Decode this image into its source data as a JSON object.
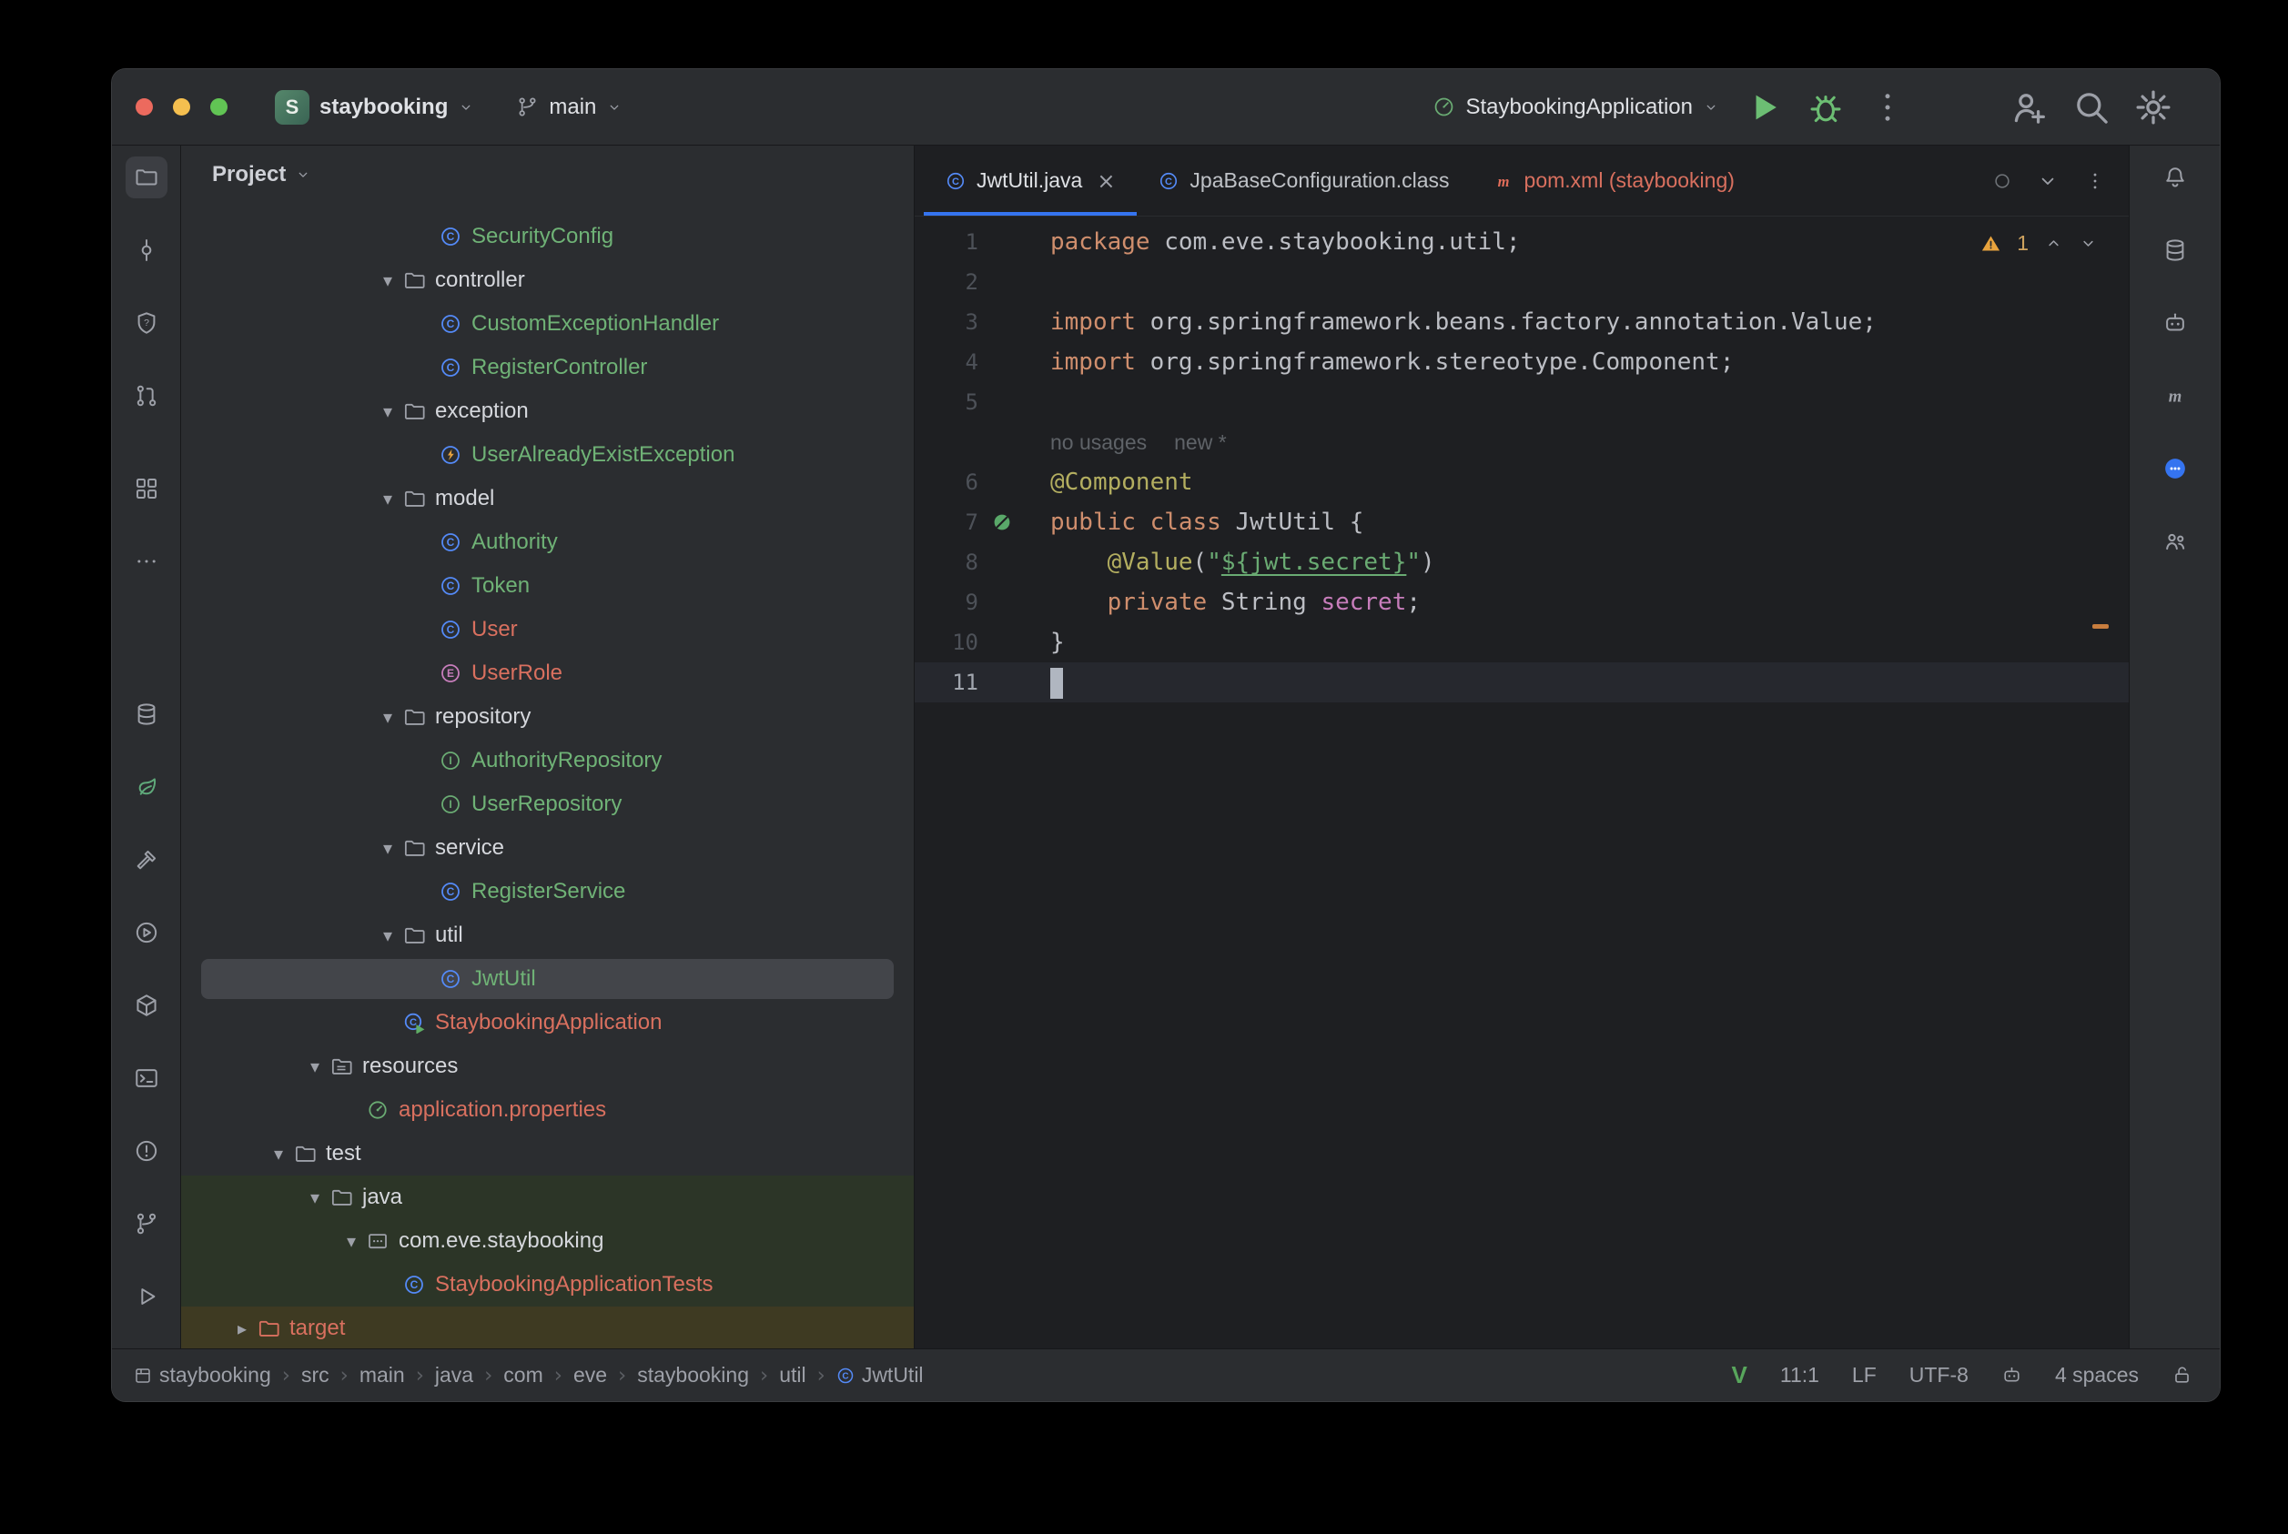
{
  "titlebar": {
    "project_badge": "S",
    "project_name": "staybooking",
    "branch_name": "main",
    "run_config_name": "StaybookingApplication"
  },
  "left_toolbar": {
    "top_icons": [
      "project-folder",
      "commit",
      "shield-question",
      "pull-requests",
      "structure",
      "more-ellipsis"
    ],
    "bottom_icons": [
      "database",
      "spring",
      "build-hammer",
      "services-play",
      "modules-cube",
      "terminal",
      "problems-error",
      "git-branch",
      "run-play"
    ]
  },
  "right_toolbar": {
    "icons": [
      "notifications-bell",
      "database",
      "ai-assistant",
      "maven-tool",
      "chat-bubble",
      "code-with-me"
    ]
  },
  "project_panel": {
    "header_label": "Project",
    "tree": [
      {
        "label": "SecurityConfig",
        "level": 5,
        "chevron": null,
        "icon": "class",
        "color": "green"
      },
      {
        "label": "controller",
        "level": 4,
        "chevron": "down",
        "icon": "folder",
        "color": "default"
      },
      {
        "label": "CustomExceptionHandler",
        "level": 5,
        "chevron": null,
        "icon": "class",
        "color": "green"
      },
      {
        "label": "RegisterController",
        "level": 5,
        "chevron": null,
        "icon": "class",
        "color": "green"
      },
      {
        "label": "exception",
        "level": 4,
        "chevron": "down",
        "icon": "folder",
        "color": "default"
      },
      {
        "label": "UserAlreadyExistException",
        "level": 5,
        "chevron": null,
        "icon": "exception-class",
        "color": "green"
      },
      {
        "label": "model",
        "level": 4,
        "chevron": "down",
        "icon": "folder",
        "color": "default"
      },
      {
        "label": "Authority",
        "level": 5,
        "chevron": null,
        "icon": "class",
        "color": "green"
      },
      {
        "label": "Token",
        "level": 5,
        "chevron": null,
        "icon": "class",
        "color": "green"
      },
      {
        "label": "User",
        "level": 5,
        "chevron": null,
        "icon": "class",
        "color": "salmon"
      },
      {
        "label": "UserRole",
        "level": 5,
        "chevron": null,
        "icon": "enum",
        "color": "salmon"
      },
      {
        "label": "repository",
        "level": 4,
        "chevron": "down",
        "icon": "folder",
        "color": "default"
      },
      {
        "label": "AuthorityRepository",
        "level": 5,
        "chevron": null,
        "icon": "interface",
        "color": "green"
      },
      {
        "label": "UserRepository",
        "level": 5,
        "chevron": null,
        "icon": "interface",
        "color": "green"
      },
      {
        "label": "service",
        "level": 4,
        "chevron": "down",
        "icon": "folder",
        "color": "default"
      },
      {
        "label": "RegisterService",
        "level": 5,
        "chevron": null,
        "icon": "class",
        "color": "green"
      },
      {
        "label": "util",
        "level": 4,
        "chevron": "down",
        "icon": "folder",
        "color": "default"
      },
      {
        "label": "JwtUtil",
        "level": 5,
        "chevron": null,
        "icon": "class",
        "color": "green",
        "selected": true
      },
      {
        "label": "StaybookingApplication",
        "level": 4,
        "chevron": null,
        "icon": "run-class",
        "color": "salmon"
      },
      {
        "label": "resources",
        "level": 2,
        "chevron": "down",
        "icon": "resources-folder",
        "color": "default"
      },
      {
        "label": "application.properties",
        "level": 3,
        "chevron": null,
        "icon": "spring-config",
        "color": "salmon"
      },
      {
        "label": "test",
        "level": 1,
        "chevron": "down",
        "icon": "folder",
        "color": "default"
      },
      {
        "label": "java",
        "level": 2,
        "chevron": "down",
        "icon": "folder",
        "color": "default",
        "row_bg": "test"
      },
      {
        "label": "com.eve.staybooking",
        "level": 3,
        "chevron": "down",
        "icon": "package",
        "color": "default",
        "row_bg": "test"
      },
      {
        "label": "StaybookingApplicationTests",
        "level": 4,
        "chevron": null,
        "icon": "class",
        "color": "salmon",
        "row_bg": "test"
      },
      {
        "label": "target",
        "level": 0,
        "chevron": "right",
        "icon": "folder",
        "color": "salmon",
        "row_bg": "excluded"
      }
    ]
  },
  "editor": {
    "tabs": [
      {
        "label": "JwtUtil.java",
        "icon": "class",
        "active": true,
        "closable": true,
        "color": "default"
      },
      {
        "label": "JpaBaseConfiguration.class",
        "icon": "class",
        "active": false,
        "closable": false,
        "color": "default"
      },
      {
        "label": "pom.xml (staybooking)",
        "icon": "maven",
        "active": false,
        "closable": false,
        "color": "salmon"
      }
    ],
    "inspection_widget": {
      "warning_count": "1"
    },
    "inlay_hint": {
      "usages": "no usages",
      "vcs": "new *"
    },
    "code_lines": [
      {
        "num": "1",
        "segments": [
          {
            "text": "package ",
            "style": "keyword"
          },
          {
            "text": "com.eve.staybooking.util;",
            "style": "plain"
          }
        ]
      },
      {
        "num": "2",
        "segments": []
      },
      {
        "num": "3",
        "segments": [
          {
            "text": "import ",
            "style": "keyword"
          },
          {
            "text": "org.springframework.beans.factory.annotation.Value;",
            "style": "plain"
          }
        ]
      },
      {
        "num": "4",
        "segments": [
          {
            "text": "import ",
            "style": "keyword"
          },
          {
            "text": "org.springframework.stereotype.Component;",
            "style": "plain"
          }
        ]
      },
      {
        "num": "5",
        "segments": []
      },
      {
        "num": "",
        "inlay": true
      },
      {
        "num": "6",
        "segments": [
          {
            "text": "@Component",
            "style": "annotation"
          }
        ]
      },
      {
        "num": "7",
        "gutter_icon": "spring-bean",
        "segments": [
          {
            "text": "public class ",
            "style": "keyword"
          },
          {
            "text": "JwtUtil {",
            "style": "plain"
          }
        ]
      },
      {
        "num": "8",
        "segments": [
          {
            "text": "    ",
            "style": "plain"
          },
          {
            "text": "@Value",
            "style": "annotation"
          },
          {
            "text": "(",
            "style": "plain"
          },
          {
            "text": "\"",
            "style": "string"
          },
          {
            "text": "${jwt.secret}",
            "style": "string-ref"
          },
          {
            "text": "\"",
            "style": "string"
          },
          {
            "text": ")",
            "style": "plain"
          }
        ]
      },
      {
        "num": "9",
        "segments": [
          {
            "text": "    ",
            "style": "plain"
          },
          {
            "text": "private ",
            "style": "keyword"
          },
          {
            "text": "String ",
            "style": "plain"
          },
          {
            "text": "secret",
            "style": "field"
          },
          {
            "text": ";",
            "style": "plain"
          }
        ]
      },
      {
        "num": "10",
        "segments": [
          {
            "text": "}",
            "style": "plain"
          }
        ]
      },
      {
        "num": "11",
        "current": true,
        "caret": true,
        "segments": []
      }
    ]
  },
  "statusbar": {
    "breadcrumbs": [
      {
        "label": "staybooking",
        "icon": "module"
      },
      {
        "label": "src"
      },
      {
        "label": "main"
      },
      {
        "label": "java"
      },
      {
        "label": "com"
      },
      {
        "label": "eve"
      },
      {
        "label": "staybooking"
      },
      {
        "label": "util"
      },
      {
        "label": "JwtUtil",
        "icon": "class"
      }
    ],
    "items": {
      "vim": "V",
      "caret_position": "11:1",
      "line_separator": "LF",
      "encoding": "UTF-8",
      "indent": "4 spaces"
    }
  },
  "colors": {
    "accent_blue": "#3574f0",
    "green_added": "#6fb276",
    "salmon_unversioned": "#d9705f",
    "keyword_orange": "#cf8e6d",
    "annotation_yellow": "#b3ae60",
    "string_green": "#6aab73",
    "field_purple": "#c77dbb",
    "editor_bg": "#1e1f22",
    "panel_bg": "#2b2d30"
  }
}
